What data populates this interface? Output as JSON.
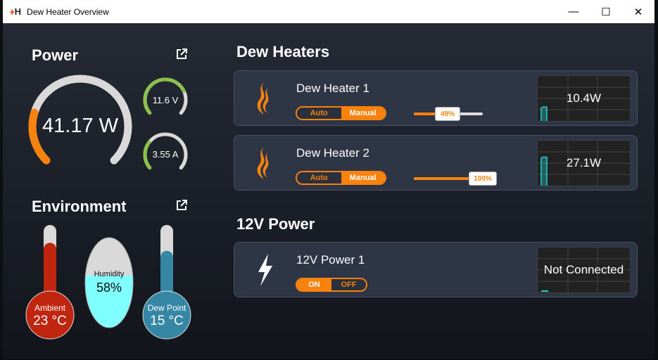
{
  "window": {
    "title": "Dew Heater Overview",
    "controls": [
      "minimize",
      "maximize",
      "close"
    ]
  },
  "colors": {
    "accent": "#f7820d",
    "gauge_green": "#8bc34a",
    "gauge_track": "#d9d9d9",
    "ambient": "#c0260f",
    "dew_point": "#3686a6",
    "humidity": "#80ffff",
    "trace": "#25d0d0"
  },
  "power": {
    "title": "Power",
    "open_icon": "external-link-icon",
    "total": {
      "label": "41.17 W",
      "fraction": 0.23
    },
    "voltage": {
      "label": "11.6 V",
      "fraction": 0.75
    },
    "current": {
      "label": "3.55 A",
      "fraction": 0.3
    }
  },
  "environment": {
    "title": "Environment",
    "open_icon": "external-link-icon",
    "ambient": {
      "label": "Ambient",
      "value": "23 °C",
      "fraction": 0.78
    },
    "humidity": {
      "label": "Humidity",
      "value": "58%",
      "fraction": 0.58
    },
    "dew_point": {
      "label": "Dew Point",
      "value": "15 °C",
      "fraction": 0.68
    }
  },
  "dew_heaters": {
    "title": "Dew Heaters",
    "items": [
      {
        "name": "Dew Heater 1",
        "icon": "flame-icon",
        "mode_auto": "Auto",
        "mode_manual": "Manual",
        "mode": "Manual",
        "power_percent": 49,
        "power_label": "49%",
        "reading": "10.4W"
      },
      {
        "name": "Dew Heater 2",
        "icon": "flame-icon",
        "mode_auto": "Auto",
        "mode_manual": "Manual",
        "mode": "Manual",
        "power_percent": 100,
        "power_label": "100%",
        "reading": "27.1W"
      }
    ]
  },
  "power_12v": {
    "title": "12V Power",
    "items": [
      {
        "name": "12V Power 1",
        "icon": "lightning-icon",
        "on_label": "ON",
        "off_label": "OFF",
        "state": "ON",
        "reading": "Not Connected"
      }
    ]
  }
}
